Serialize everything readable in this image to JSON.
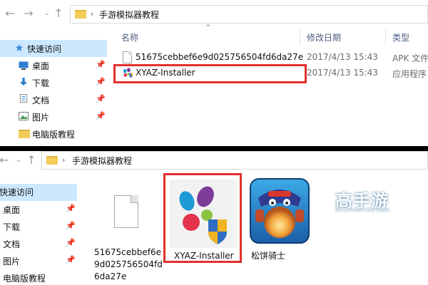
{
  "top_window": {
    "address": {
      "folder_name": "手游模拟器教程"
    },
    "columns": {
      "name": "名称",
      "date": "修改日期",
      "type": "类型"
    },
    "sidebar": [
      {
        "label": "快速访问",
        "icon": "star-icon",
        "selected": true
      },
      {
        "label": "桌面",
        "icon": "desktop-icon",
        "pinned": true
      },
      {
        "label": "下载",
        "icon": "download-icon",
        "pinned": true
      },
      {
        "label": "文档",
        "icon": "document-icon",
        "pinned": true
      },
      {
        "label": "图片",
        "icon": "picture-icon",
        "pinned": true
      },
      {
        "label": "电脑版教程",
        "icon": "folder-icon",
        "pinned": false
      }
    ],
    "files": [
      {
        "name": "51675cebbef6e9d025756504fd6da27e",
        "date": "2017/4/13 15:43",
        "type": "APK 文件",
        "icon": "blank-file-icon"
      },
      {
        "name": "XYAZ-Installer",
        "date": "2017/4/13 15:43",
        "type": "应用程序",
        "icon": "xyaz-app-icon"
      }
    ]
  },
  "bottom_window": {
    "address": {
      "folder_name": "手游模拟器教程"
    },
    "sidebar": [
      {
        "label": "快速访问",
        "selected": true
      },
      {
        "label": "桌面",
        "pinned": true
      },
      {
        "label": "下载",
        "pinned": true
      },
      {
        "label": "文档",
        "pinned": true
      },
      {
        "label": "图片",
        "pinned": true
      },
      {
        "label": "电脑版教程",
        "pinned": false
      }
    ],
    "tiles": [
      {
        "label_lines": [
          "51675cebbef6e",
          "9d025756504fd",
          "6da27e"
        ],
        "icon": "blank-file-icon"
      },
      {
        "label_lines": [
          "XYAZ-Installer"
        ],
        "icon": "xyaz-app-icon"
      },
      {
        "label_lines": [
          "松饼骑士"
        ],
        "icon": "game-icon"
      }
    ]
  },
  "watermark": {
    "main": "高手游",
    "sub": "GAOSHOUYOU.COM"
  },
  "colors": {
    "highlight": "#e0312d",
    "selection": "#cce8ff",
    "folder": "#f4cc58",
    "header_text": "#4d6082"
  }
}
